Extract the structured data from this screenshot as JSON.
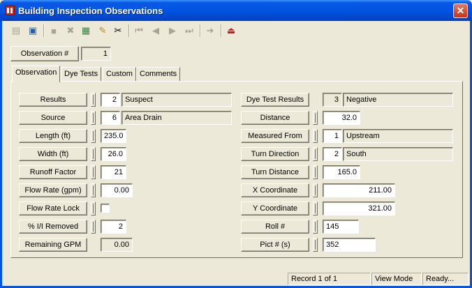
{
  "window": {
    "title": "Building Inspection Observations",
    "close_glyph": "✕"
  },
  "toolbar": {
    "buttons": [
      {
        "name": "copy-icon",
        "glyph": "▤",
        "enabled": false
      },
      {
        "name": "open-record-icon",
        "glyph": "▣",
        "enabled": true
      },
      {
        "name": "save-icon",
        "glyph": "■",
        "enabled": false
      },
      {
        "name": "delete-icon",
        "glyph": "✖",
        "enabled": false
      },
      {
        "name": "stack-icon",
        "glyph": "▦",
        "enabled": true
      },
      {
        "name": "edit-pencil-icon",
        "glyph": "✎",
        "enabled": true
      },
      {
        "name": "cut-icon",
        "glyph": "✂",
        "enabled": true
      },
      {
        "name": "first-record-icon",
        "glyph": "⏮",
        "enabled": false
      },
      {
        "name": "prev-record-icon",
        "glyph": "◀",
        "enabled": false
      },
      {
        "name": "next-record-icon",
        "glyph": "▶",
        "enabled": false
      },
      {
        "name": "last-record-icon",
        "glyph": "⏭",
        "enabled": false
      },
      {
        "name": "goto-icon",
        "glyph": "➜",
        "enabled": false
      },
      {
        "name": "exit-icon",
        "glyph": "⏏",
        "enabled": true
      }
    ]
  },
  "header": {
    "observation_label": "Observation #",
    "observation_value": "1"
  },
  "tabs": [
    "Observation",
    "Dye Tests",
    "Custom",
    "Comments"
  ],
  "left": {
    "results": {
      "label": "Results",
      "code": "2",
      "desc": "Suspect"
    },
    "source": {
      "label": "Source",
      "code": "6",
      "desc": "Area Drain"
    },
    "length": {
      "label": "Length (ft)",
      "value": "235.0"
    },
    "width": {
      "label": "Width (ft)",
      "value": "26.0"
    },
    "runoff": {
      "label": "Runoff Factor",
      "value": "21"
    },
    "flow_rate": {
      "label": "Flow Rate (gpm)",
      "value": "0.00"
    },
    "flow_lock": {
      "label": "Flow Rate Lock"
    },
    "ii_removed": {
      "label": "% I/I Removed",
      "value": "2"
    },
    "remaining": {
      "label": "Remaining GPM",
      "value": "0.00"
    }
  },
  "right": {
    "dye_results": {
      "label": "Dye Test Results",
      "code": "3",
      "desc": "Negative"
    },
    "distance": {
      "label": "Distance",
      "value": "32.0"
    },
    "measured_from": {
      "label": "Measured From",
      "code": "1",
      "desc": "Upstream"
    },
    "turn_direction": {
      "label": "Turn Direction",
      "code": "2",
      "desc": "South"
    },
    "turn_distance": {
      "label": "Turn Distance",
      "value": "165.0"
    },
    "x_coord": {
      "label": "X Coordinate",
      "value": "211.00"
    },
    "y_coord": {
      "label": "Y Coordinate",
      "value": "321.00"
    },
    "roll": {
      "label": "Roll #",
      "value": "145"
    },
    "pict": {
      "label": "Pict # (s)",
      "value": "352"
    }
  },
  "status": {
    "record": "Record 1 of 1",
    "mode": "View Mode",
    "state": "Ready..."
  }
}
